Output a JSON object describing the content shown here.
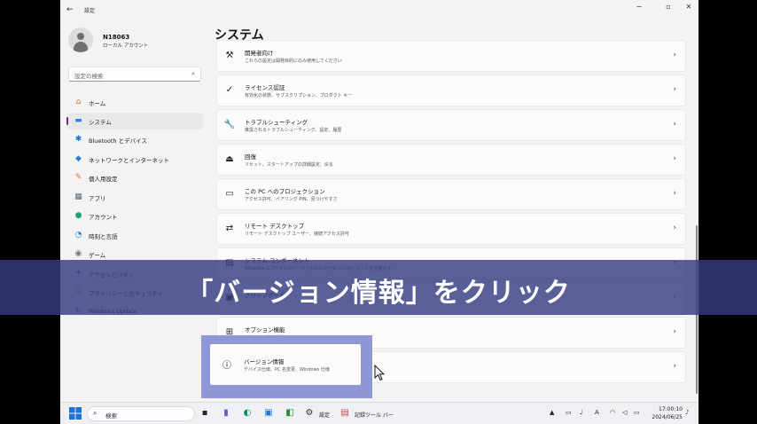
{
  "window": {
    "title": "設定",
    "back_icon": "←",
    "minimize": "−",
    "maximize": "▫",
    "close": "✕"
  },
  "user": {
    "name": "N18063",
    "type": "ローカル アカウント"
  },
  "search": {
    "placeholder": "設定の検索",
    "icon": "⌕"
  },
  "nav": [
    {
      "label": "ホーム",
      "icon": "home-icon",
      "glyph": "⌂",
      "color": "#d9692e",
      "selected": false
    },
    {
      "label": "システム",
      "icon": "system-icon",
      "glyph": "▬",
      "color": "#2b88d8",
      "selected": true
    },
    {
      "label": "Bluetooth とデバイス",
      "icon": "bluetooth-icon",
      "glyph": "✱",
      "color": "#1f6fd1",
      "selected": false
    },
    {
      "label": "ネットワークとインターネット",
      "icon": "wifi-icon",
      "glyph": "◆",
      "color": "#2a7bd3",
      "selected": false
    },
    {
      "label": "個人用設定",
      "icon": "brush-icon",
      "glyph": "✎",
      "color": "#e0793a",
      "selected": false
    },
    {
      "label": "アプリ",
      "icon": "apps-icon",
      "glyph": "▦",
      "color": "#5a6b82",
      "selected": false
    },
    {
      "label": "アカウント",
      "icon": "account-icon",
      "glyph": "●",
      "color": "#1aa36b",
      "selected": false
    },
    {
      "label": "時刻と言語",
      "icon": "clock-globe-icon",
      "glyph": "◔",
      "color": "#2a7bd3",
      "selected": false
    },
    {
      "label": "ゲーム",
      "icon": "gamepad-icon",
      "glyph": "◉",
      "color": "#777777",
      "selected": false
    },
    {
      "label": "アクセシビリティ",
      "icon": "accessibility-icon",
      "glyph": "✦",
      "color": "#2a7bd3",
      "selected": false
    },
    {
      "label": "プライバシーとセキュリティ",
      "icon": "shield-icon",
      "glyph": "⛉",
      "color": "#6b7380",
      "selected": false
    },
    {
      "label": "Windows Update",
      "icon": "update-icon",
      "glyph": "↻",
      "color": "#2a7bd3",
      "selected": false
    }
  ],
  "main": {
    "title": "システム",
    "cards": [
      {
        "title": "開発者向け",
        "subtitle": "これらの設定は開発目的にのみ使用してください",
        "icon": "developer-icon",
        "glyph": "⚒"
      },
      {
        "title": "ライセンス認証",
        "subtitle": "有効化の状態、サブスクリプション、プロダクト キー",
        "icon": "activation-check-icon",
        "glyph": "✓"
      },
      {
        "title": "トラブルシューティング",
        "subtitle": "推奨されるトラブルシューティング、設定、履歴",
        "icon": "wrench-icon",
        "glyph": "🔧"
      },
      {
        "title": "回復",
        "subtitle": "リセット、スタートアップの詳細設定、戻る",
        "icon": "recovery-icon",
        "glyph": "⏏"
      },
      {
        "title": "この PC へのプロジェクション",
        "subtitle": "アクセス許可、ペアリング PIN、見つけやすさ",
        "icon": "projection-icon",
        "glyph": "▭"
      },
      {
        "title": "リモート デスクトップ",
        "subtitle": "リモート デスクトップ ユーザー、接続アクセス許可",
        "icon": "remote-desktop-icon",
        "glyph": "⇄"
      },
      {
        "title": "システム コンポーネント",
        "subtitle": "Windows にプリインストールされたシステム コンポーネントを管理する",
        "icon": "components-icon",
        "glyph": "▤"
      },
      {
        "title": "クリップボード",
        "subtitle": "",
        "icon": "clipboard-icon",
        "glyph": "▣"
      },
      {
        "title": "オプション機能",
        "subtitle": "デバイスの追加機能",
        "icon": "optional-features-icon",
        "glyph": "⊞"
      },
      {
        "title": "バージョン情報",
        "subtitle": "デバイス仕様、PC 名変更、Windows 仕様",
        "icon": "info-icon",
        "glyph": "ⓘ"
      }
    ]
  },
  "caption": "「バージョン情報」をクリック",
  "taskbar": {
    "search_label": "検索",
    "settings_label": "設定",
    "notes_label": "記録ツール バー",
    "time": "17:00:10",
    "date": "2024/06/25"
  },
  "colors": {
    "highlight": "#8f97d9",
    "caption_bg": "#343c80",
    "accent": "#7a1fa0"
  }
}
